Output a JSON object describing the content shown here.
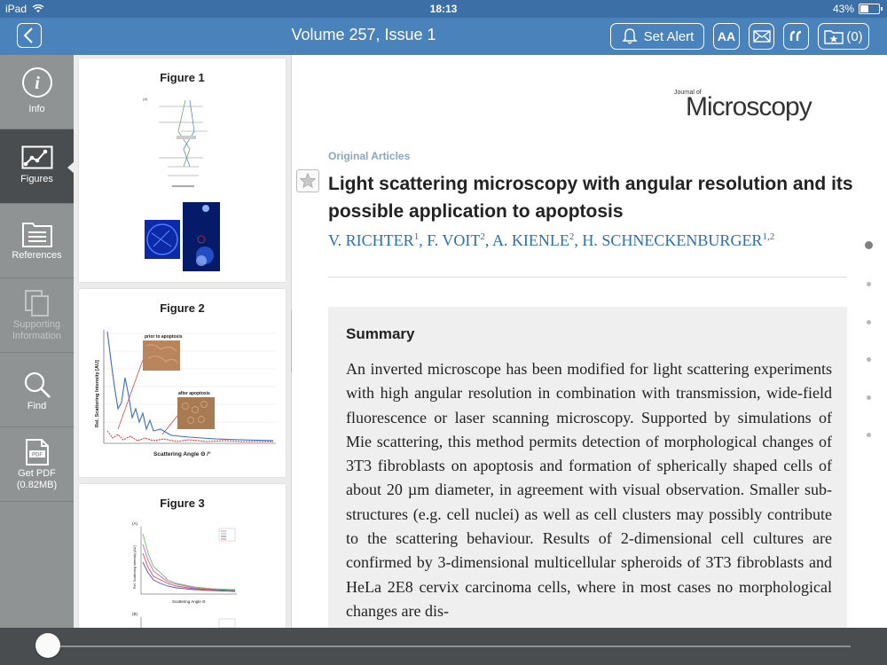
{
  "status_bar": {
    "device": "iPad",
    "time": "18:13",
    "battery": "43%",
    "battery_level": 0.43
  },
  "nav": {
    "title": "Volume 257, Issue 1",
    "set_alert_label": "Set Alert",
    "font_size_label": "AA",
    "saved_count_label": "(0)"
  },
  "sidebar": {
    "items": [
      {
        "label": "Info",
        "icon": "info-icon"
      },
      {
        "label": "Figures",
        "icon": "chart-icon"
      },
      {
        "label": "References",
        "icon": "references-icon"
      },
      {
        "label": "Supporting Information",
        "icon": "copy-icon"
      },
      {
        "label": "Find",
        "icon": "search-icon"
      },
      {
        "label": "Get PDF",
        "sublabel": "(0.82MB)",
        "icon": "pdf-icon"
      }
    ]
  },
  "figures": {
    "items": [
      {
        "title": "Figure 1"
      },
      {
        "title": "Figure 2",
        "ylabel": "Rel. Scattering Intensity [AU]",
        "xlabel": "Scattering Angle Θ /°",
        "inset1": "prior to apoptosis",
        "inset2": "after apoptosis"
      },
      {
        "title": "Figure 3",
        "ylabel": "Rel. Scattering Intensity [AU]",
        "xlabel": "Scattering Angle Θ",
        "panel_a": "(A)",
        "panel_b": "(B)"
      }
    ]
  },
  "article": {
    "journal_small": "Journal of",
    "journal_name": "Microscopy",
    "section": "Original Articles",
    "title": "Light scattering microscopy with angular resolution and its possible application to apoptosis",
    "authors": [
      {
        "name": "V. RICHTER",
        "aff": "1",
        "sep": ", "
      },
      {
        "name": "F. VOIT",
        "aff": "2",
        "sep": ", "
      },
      {
        "name": "A. KIENLE",
        "aff": "2",
        "sep": ", "
      },
      {
        "name": "H. SCHNECKENBURGER",
        "aff": "1,2",
        "sep": ""
      }
    ],
    "summary_heading": "Summary",
    "summary_text": "An inverted microscope has been modified for light scattering experiments with high angular resolution in combination with transmission, wide-field fluorescence or laser scanning microscopy. Supported by simulations of Mie scattering, this method permits detection of morphological changes of 3T3 fibroblasts on apoptosis and formation of spherically shaped cells of about 20 µm diameter, in agreement with visual observation. Smaller sub-structures (e.g. cell nuclei) as well as cell clusters may possibly contribute to the scattering behaviour. Results of 2-dimensional cell cultures are confirmed by 3-dimensional multicellular spheroids of 3T3 fibroblasts and HeLa 2E8 cervix carcinoma cells, where in most cases no morphological changes are dis-"
  },
  "scrubber": {
    "position": 0.0
  },
  "colors": {
    "nav": "#4a82bb",
    "status": "#3b6fa6",
    "sidebar": "#8f9394",
    "active": "#4a4d4f",
    "link": "#2a6fb0",
    "section": "#8aa6c1"
  }
}
